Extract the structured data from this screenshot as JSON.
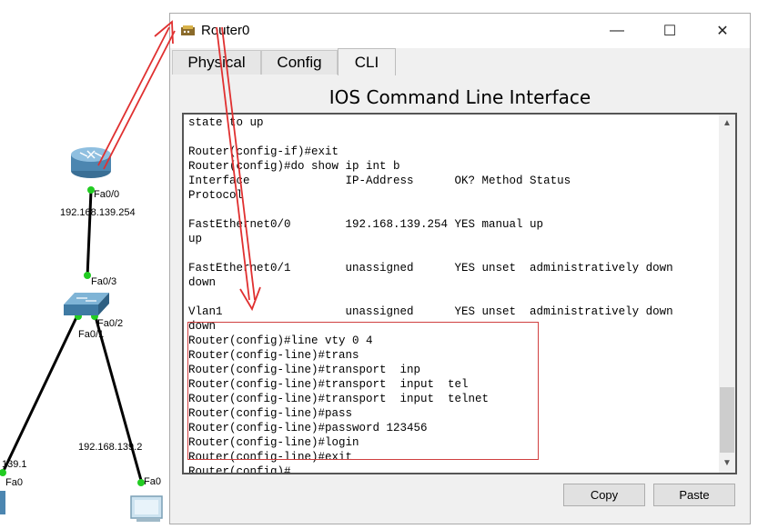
{
  "topology": {
    "router_port": "Fa0/0",
    "router_ip": "192.168.139.254",
    "switch_port_up": "Fa0/3",
    "switch_port_right": "Fa0/2",
    "switch_port_left": "Fa0/1",
    "left_device_ip": "139.1",
    "left_device_port": "Fa0",
    "right_device_ip": "192.168.139.2",
    "right_device_port": "Fa0"
  },
  "window": {
    "title": "Router0",
    "title_icon": "router-icon",
    "minimize_glyph": "—",
    "maximize_glyph": "☐",
    "close_glyph": "✕"
  },
  "tabs": [
    {
      "label": "Physical",
      "active": false
    },
    {
      "label": "Config",
      "active": false
    },
    {
      "label": "CLI",
      "active": true
    }
  ],
  "cli": {
    "heading": "IOS Command Line Interface",
    "terminal_text": "state to up\n\nRouter(config-if)#exit\nRouter(config)#do show ip int b\nInterface              IP-Address      OK? Method Status\nProtocol\n\nFastEthernet0/0        192.168.139.254 YES manual up\nup\n\nFastEthernet0/1        unassigned      YES unset  administratively down\ndown\n\nVlan1                  unassigned      YES unset  administratively down\ndown\nRouter(config)#line vty 0 4\nRouter(config-line)#trans\nRouter(config-line)#transport  inp\nRouter(config-line)#transport  input  tel\nRouter(config-line)#transport  input  telnet\nRouter(config-line)#pass\nRouter(config-line)#password 123456\nRouter(config-line)#login\nRouter(config-line)#exit\nRouter(config)#"
  },
  "buttons": {
    "copy": "Copy",
    "paste": "Paste"
  },
  "colors": {
    "annotation_red": "#e03030",
    "link_black": "#000000",
    "port_green": "#22cc22"
  }
}
